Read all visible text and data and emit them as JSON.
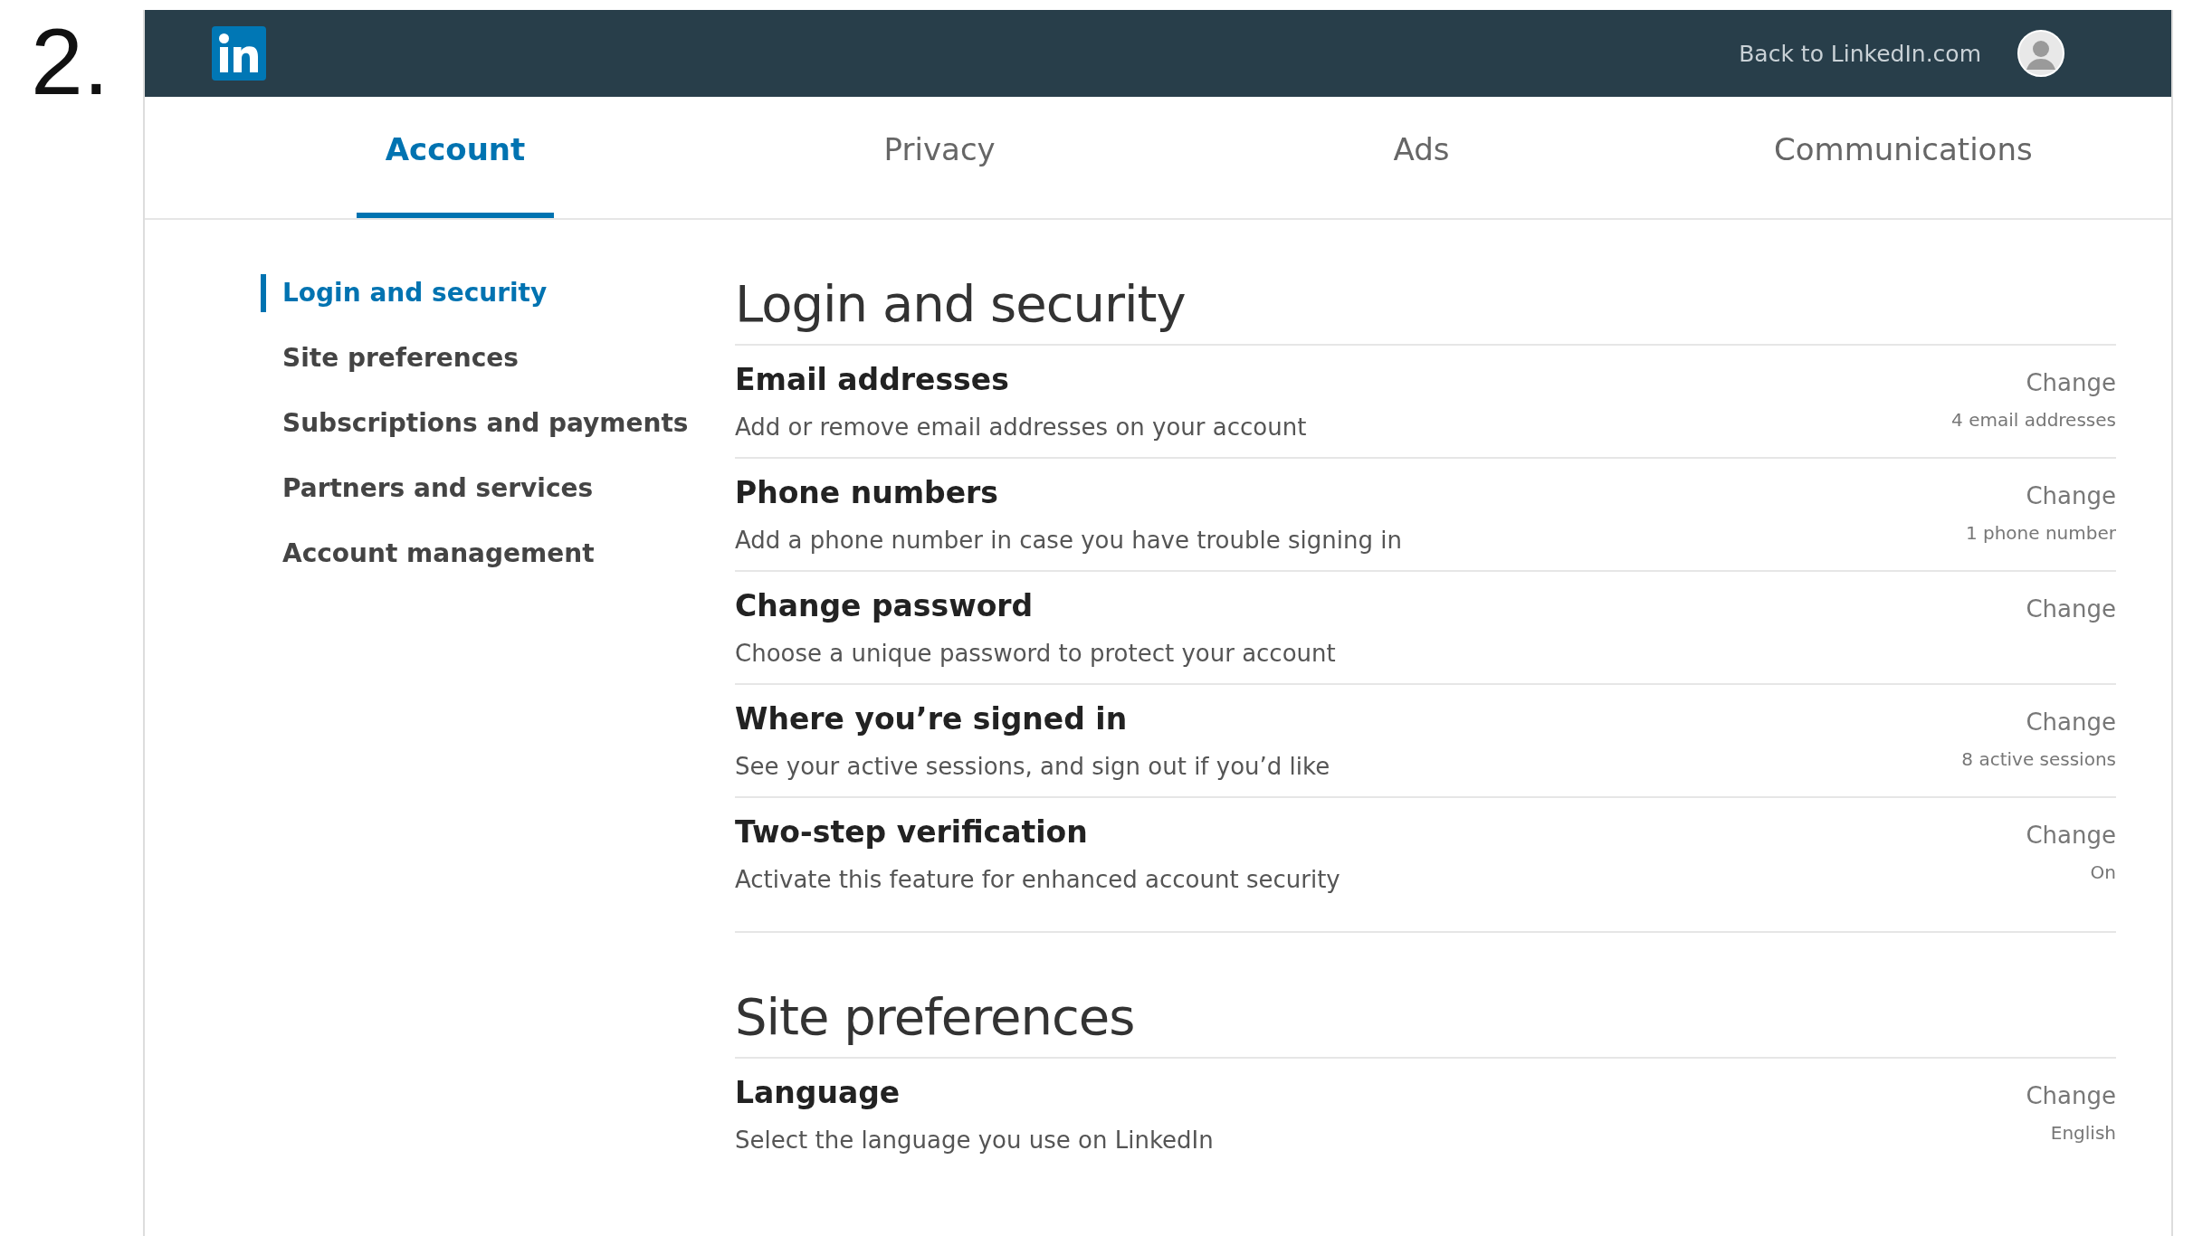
{
  "slide_number": "2.",
  "top_bar": {
    "back_link": "Back to LinkedIn.com"
  },
  "tabs": [
    {
      "label": "Account",
      "selected": true
    },
    {
      "label": "Privacy",
      "selected": false
    },
    {
      "label": "Ads",
      "selected": false
    },
    {
      "label": "Communications",
      "selected": false
    }
  ],
  "sidebar": {
    "items": [
      {
        "label": "Login and security",
        "selected": true
      },
      {
        "label": "Site preferences",
        "selected": false
      },
      {
        "label": "Subscriptions and payments",
        "selected": false
      },
      {
        "label": "Partners and services",
        "selected": false
      },
      {
        "label": "Account management",
        "selected": false
      }
    ]
  },
  "sections": [
    {
      "title": "Login and security",
      "rows": [
        {
          "title": "Email addresses",
          "description": "Add or remove email addresses on your account",
          "action": "Change",
          "meta": "4 email addresses"
        },
        {
          "title": "Phone numbers",
          "description": "Add a phone number in case you have trouble signing in",
          "action": "Change",
          "meta": "1 phone number"
        },
        {
          "title": "Change password",
          "description": "Choose a unique password to protect your account",
          "action": "Change"
        },
        {
          "title": "Where you’re signed in",
          "description": "See your active sessions, and sign out if you’d like",
          "action": "Change",
          "meta": "8 active sessions"
        },
        {
          "title": "Two-step verification",
          "description": "Activate this feature for enhanced account security",
          "action": "Change",
          "meta": "On"
        }
      ]
    },
    {
      "title": "Site preferences",
      "rows": [
        {
          "title": "Language",
          "description": "Select the language you use on LinkedIn",
          "action": "Change",
          "meta": "English"
        }
      ]
    }
  ]
}
